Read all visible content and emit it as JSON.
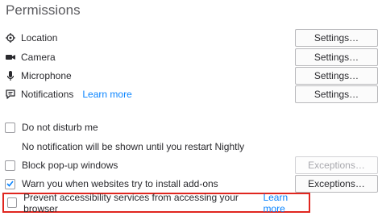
{
  "header": {
    "title": "Permissions"
  },
  "permissions": [
    {
      "label": "Location",
      "icon": "location-icon",
      "button": "Settings…"
    },
    {
      "label": "Camera",
      "icon": "camera-icon",
      "button": "Settings…"
    },
    {
      "label": "Microphone",
      "icon": "microphone-icon",
      "button": "Settings…"
    },
    {
      "label": "Notifications",
      "icon": "notification-icon",
      "button": "Settings…",
      "learn_more": "Learn more"
    }
  ],
  "dnd": {
    "label": "Do not disturb me",
    "checked": false,
    "description": "No notification will be shown until you restart Nightly"
  },
  "popups": {
    "label": "Block pop-up windows",
    "checked": false,
    "button": "Exceptions…",
    "button_disabled": true
  },
  "addons": {
    "label": "Warn you when websites try to install add-ons",
    "checked": true,
    "button": "Exceptions…"
  },
  "accessibility": {
    "label": "Prevent accessibility services from accessing your browser",
    "checked": false,
    "learn_more": "Learn more"
  },
  "colors": {
    "link": "#0a84ff",
    "highlight_border": "#e0261f"
  }
}
